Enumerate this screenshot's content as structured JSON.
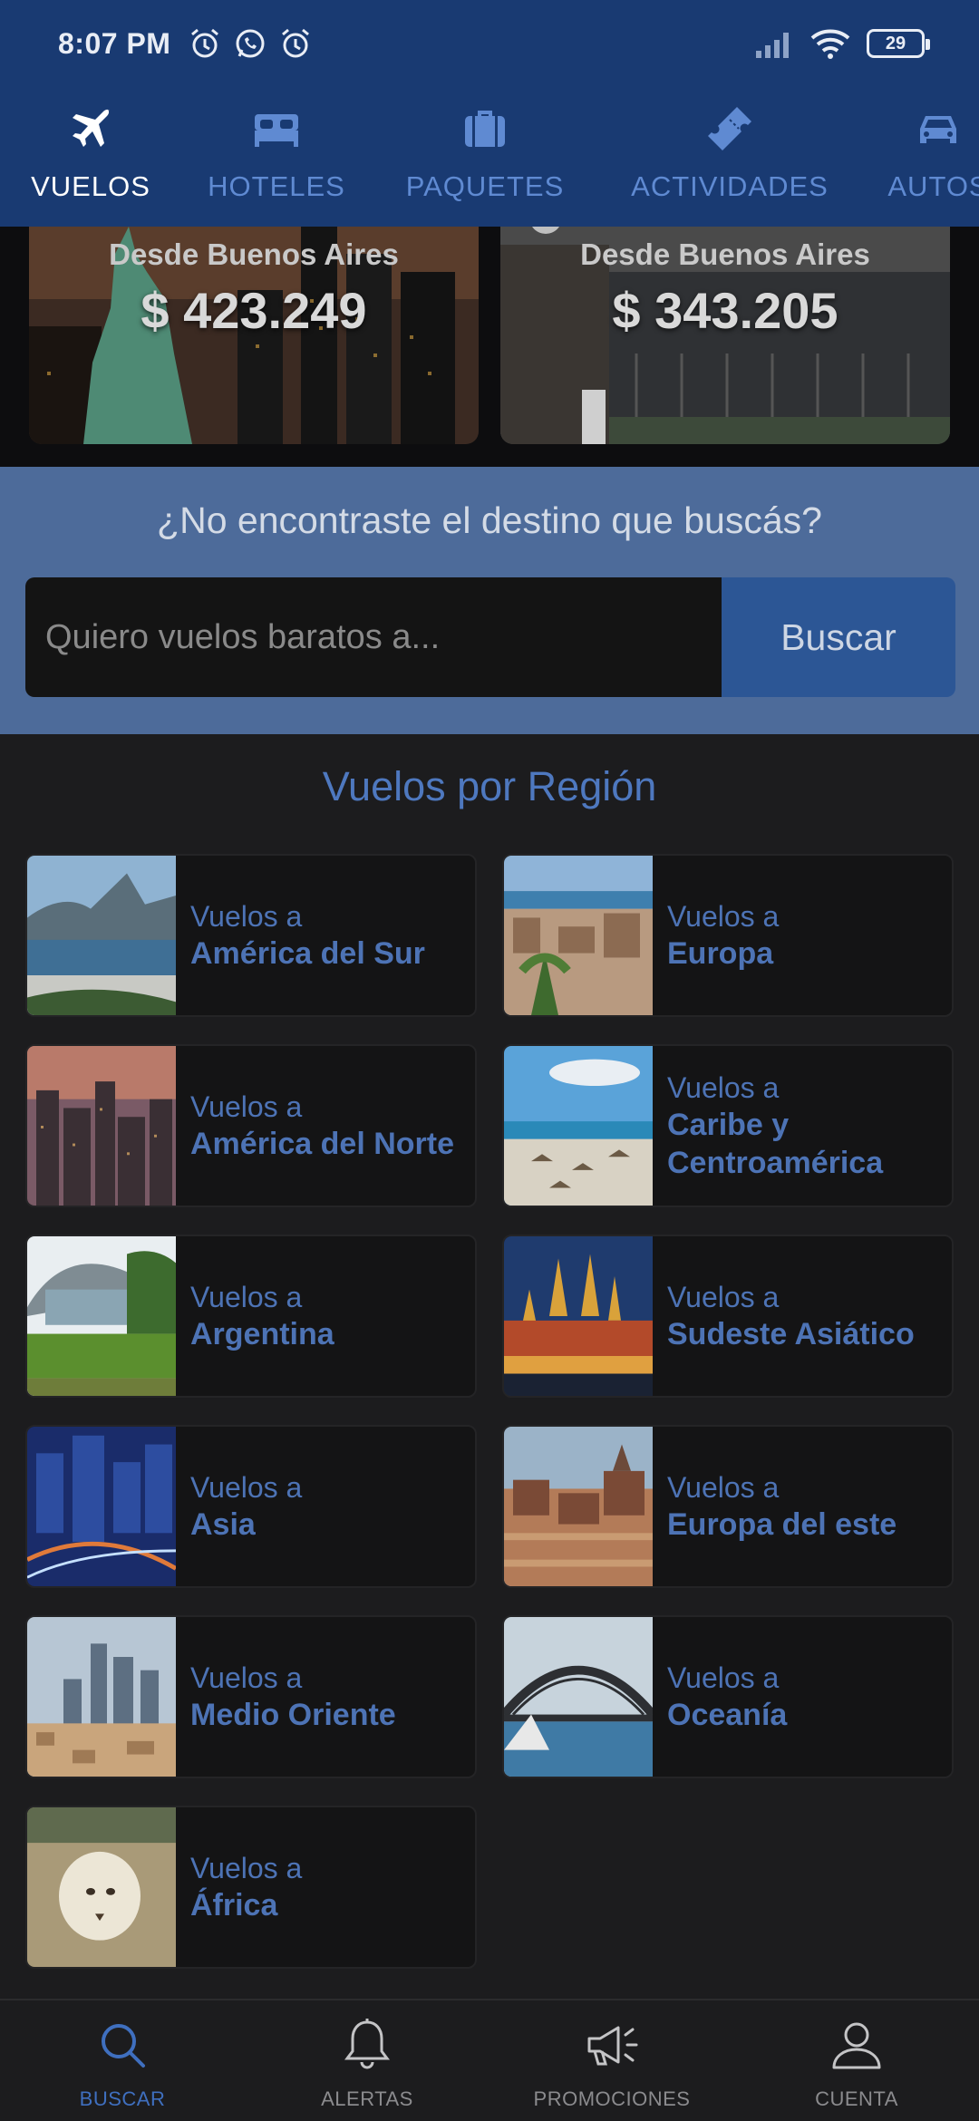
{
  "status_bar": {
    "time": "8:07 PM",
    "battery": "29",
    "left_icons": [
      "alarm-icon",
      "whatsapp-icon",
      "alarm-icon"
    ],
    "right_icons": [
      "signal-icon",
      "wifi-icon",
      "battery-icon"
    ]
  },
  "tabs": [
    {
      "label": "VUELOS",
      "icon": "airplane-icon",
      "active": true
    },
    {
      "label": "HOTELES",
      "icon": "bed-icon",
      "active": false
    },
    {
      "label": "PAQUETES",
      "icon": "suitcase-icon",
      "active": false
    },
    {
      "label": "ACTIVIDADES",
      "icon": "ticket-icon",
      "active": false
    },
    {
      "label": "AUTOS",
      "icon": "car-icon",
      "active": false
    }
  ],
  "featured": [
    {
      "from": "Desde Buenos Aires",
      "price": "$ 423.249"
    },
    {
      "from": "Desde Buenos Aires",
      "price": "$ 343.205"
    }
  ],
  "search": {
    "question": "¿No encontraste el destino que buscás?",
    "placeholder": "Quiero vuelos baratos a...",
    "button": "Buscar"
  },
  "regions": {
    "title": "Vuelos por Región",
    "items": [
      {
        "prefix": "Vuelos a",
        "name": "América del Sur"
      },
      {
        "prefix": "Vuelos a",
        "name": "Europa"
      },
      {
        "prefix": "Vuelos a",
        "name": "América del Norte"
      },
      {
        "prefix": "Vuelos a",
        "name": "Caribe y Centroamérica"
      },
      {
        "prefix": "Vuelos a",
        "name": "Argentina"
      },
      {
        "prefix": "Vuelos a",
        "name": "Sudeste Asiático"
      },
      {
        "prefix": "Vuelos a",
        "name": "Asia"
      },
      {
        "prefix": "Vuelos a",
        "name": "Europa del este"
      },
      {
        "prefix": "Vuelos a",
        "name": "Medio Oriente"
      },
      {
        "prefix": "Vuelos a",
        "name": "Oceanía"
      },
      {
        "prefix": "Vuelos a",
        "name": "África"
      }
    ]
  },
  "bottom_nav": [
    {
      "label": "BUSCAR",
      "icon": "search-icon",
      "active": true
    },
    {
      "label": "ALERTAS",
      "icon": "bell-icon",
      "active": false
    },
    {
      "label": "PROMOCIONES",
      "icon": "megaphone-icon",
      "active": false
    },
    {
      "label": "CUENTA",
      "icon": "user-icon",
      "active": false
    }
  ],
  "colors": {
    "header": "#193a72",
    "accent": "#4d73b5",
    "search_band": "#4d6b9a",
    "background": "#1c1c1e"
  }
}
